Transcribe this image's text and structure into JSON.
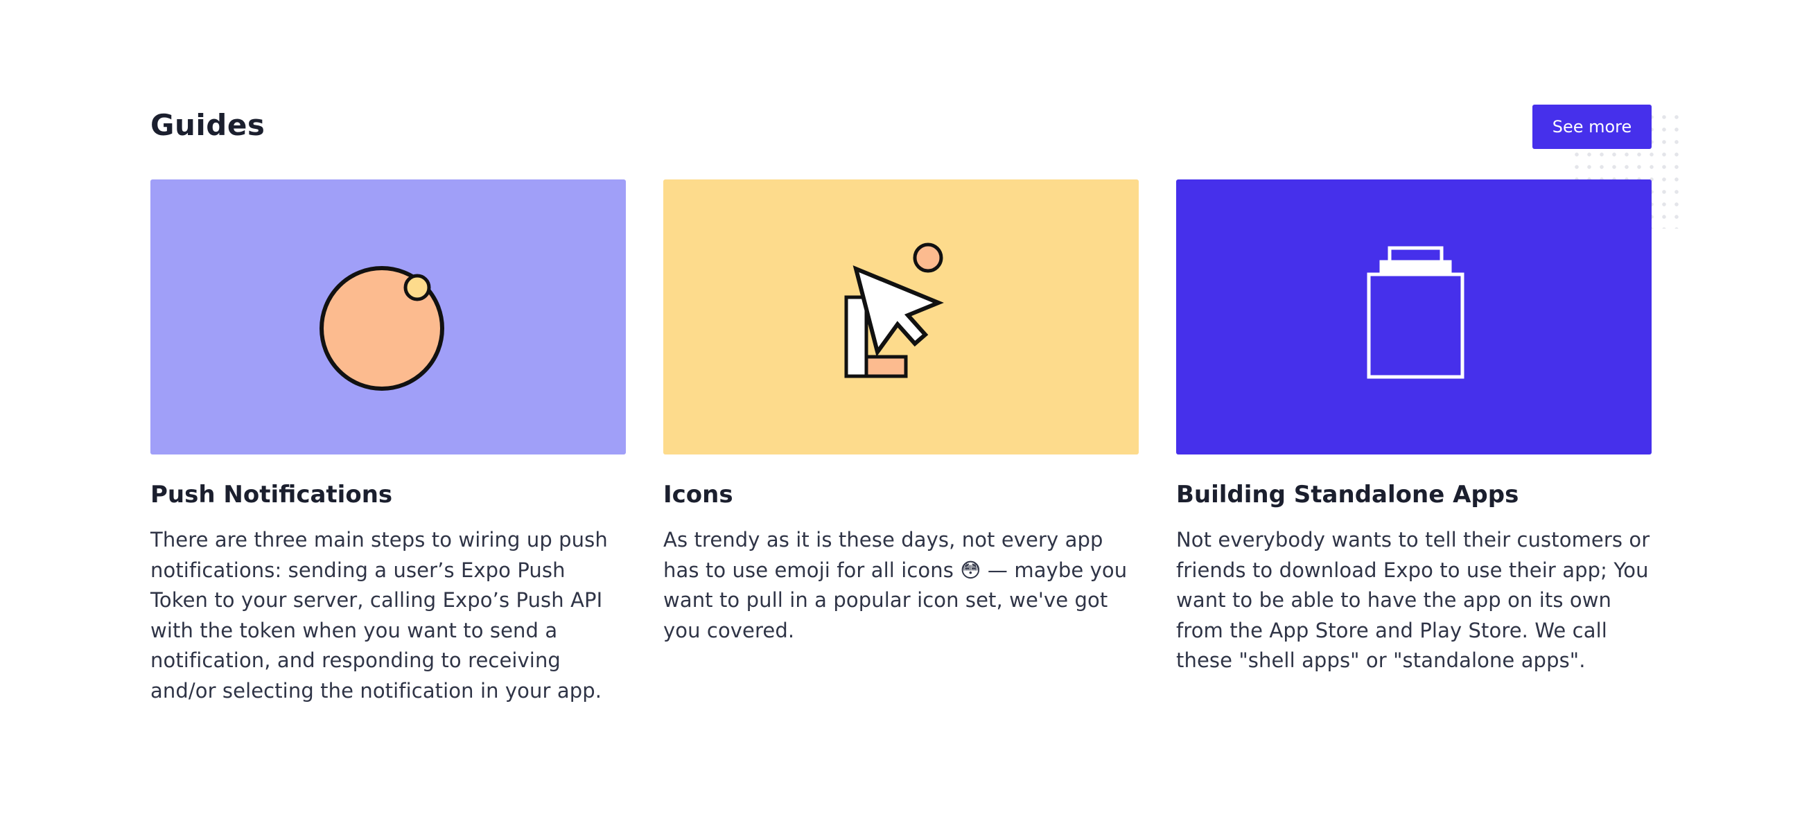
{
  "guides": {
    "title": "Guides",
    "see_more_label": "See more",
    "cards": [
      {
        "title": "Push Notifications",
        "description": "There are three main steps to wiring up push notifications: sending a user’s Expo Push Token to your server, calling Expo’s Push API with the token when you want to send a notification, and responding to receiving and/or selecting the notification in your app.",
        "background": "#a09ff8",
        "icon": "notification-dot-icon"
      },
      {
        "title": "Icons",
        "description": "As trendy as it is these days, not every app has to use emoji for all icons 😳 — maybe you want to pull in a popular icon set, we've got you covered.",
        "background": "#fddb8c",
        "icon": "cursor-icon"
      },
      {
        "title": "Building Standalone Apps",
        "description": "Not everybody wants to tell their customers or friends to download Expo to use their app; You want to be able to have the app on its own from the App Store and Play Store. We call these \"shell apps\" or \"standalone apps\".",
        "background": "#4630eb",
        "icon": "shopping-bag-icon"
      }
    ]
  },
  "colors": {
    "accent": "#4630eb",
    "peach": "#fcbb8f",
    "yellow": "#fddb8c",
    "lavender": "#a09ff8"
  }
}
